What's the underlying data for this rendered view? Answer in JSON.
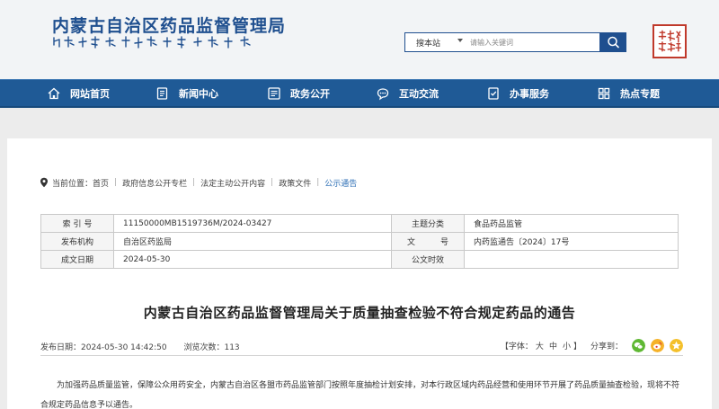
{
  "header": {
    "site_title": "内蒙古自治区药品监督管理局",
    "search": {
      "scope": "搜本站",
      "placeholder": "请输入关键词"
    }
  },
  "nav": {
    "items": [
      {
        "label": "网站首页",
        "icon": "home-icon"
      },
      {
        "label": "新闻中心",
        "icon": "news-icon"
      },
      {
        "label": "政务公开",
        "icon": "document-icon"
      },
      {
        "label": "互动交流",
        "icon": "chat-icon"
      },
      {
        "label": "办事服务",
        "icon": "service-icon"
      },
      {
        "label": "热点专题",
        "icon": "grid-icon"
      }
    ]
  },
  "breadcrumb": {
    "label": "当前位置：",
    "items": [
      "首页",
      "政府信息公开专栏",
      "法定主动公开内容",
      "政策文件",
      "公示通告"
    ]
  },
  "meta": {
    "index_label": "索 引 号",
    "index_value": "11150000MB1519736M/2024-03427",
    "category_label": "主题分类",
    "category_value": "食品药品监管",
    "publisher_label": "发布机构",
    "publisher_value": "自治区药监局",
    "docno_label_a": "文",
    "docno_label_b": "号",
    "docno_value": "内药监通告〔2024〕17号",
    "date_label": "成文日期",
    "date_value": "2024-05-30",
    "effect_label": "公文时效",
    "effect_value": ""
  },
  "article": {
    "title": "内蒙古自治区药品监督管理局关于质量抽查检验不符合规定药品的通告",
    "publish_time": "发布日期：2024-05-30 14:42:50",
    "views": "浏览次数：113",
    "font_label": "【字体：",
    "font_large": "大",
    "font_medium": "中",
    "font_small": "小",
    "font_close": "】",
    "share_label": "分享到：",
    "share_icons": [
      "wechat-icon",
      "weibo-icon",
      "qzone-icon"
    ],
    "body": "为加强药品质量监管，保障公众用药安全，内蒙古自治区各盟市药品监管部门按照年度抽检计划安排，对本行政区域内药品经营和使用环节开展了药品质量抽查检验，现将不符合规定药品信息予以通告。"
  },
  "colors": {
    "brand_blue": "#1f5a96",
    "link_blue": "#2c6eb5",
    "seal_red": "#c0392b"
  }
}
